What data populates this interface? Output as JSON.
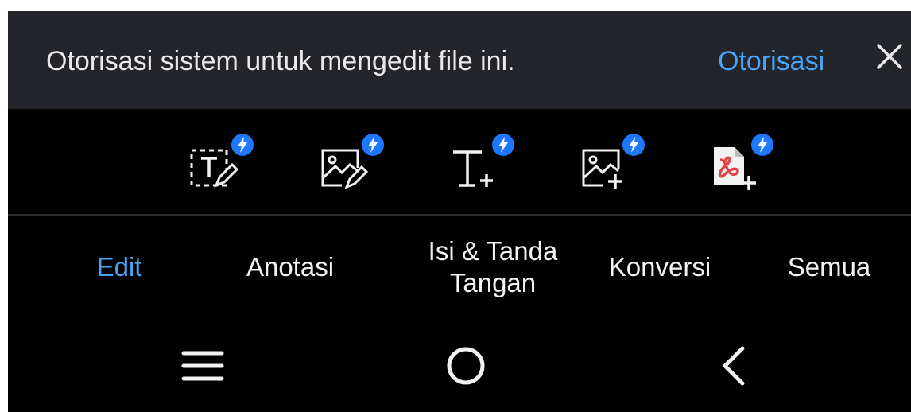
{
  "banner": {
    "message": "Otorisasi sistem untuk mengedit file ini.",
    "action_label": "Otorisasi",
    "close_icon": "close-icon"
  },
  "toolbar": {
    "tools": [
      {
        "icon": "edit-text-icon",
        "badge": "lightning-badge-icon"
      },
      {
        "icon": "edit-image-icon",
        "badge": "lightning-badge-icon"
      },
      {
        "icon": "add-text-icon",
        "badge": "lightning-badge-icon"
      },
      {
        "icon": "add-image-icon",
        "badge": "lightning-badge-icon"
      },
      {
        "icon": "add-pdf-page-icon",
        "badge": "lightning-badge-icon"
      }
    ]
  },
  "tabs": [
    {
      "label": "Edit",
      "active": true
    },
    {
      "label": "Anotasi",
      "active": false
    },
    {
      "label": "Isi & Tanda Tangan",
      "active": false
    },
    {
      "label": "Konversi",
      "active": false
    },
    {
      "label": "Semua",
      "active": false
    }
  ],
  "nav": {
    "recents_icon": "recents-menu-icon",
    "home_icon": "home-circle-icon",
    "back_icon": "back-chevron-icon"
  },
  "colors": {
    "accent": "#4aa3f5",
    "badge": "#1e78ff",
    "pdf_red": "#e0434a",
    "banner_bg": "#23252b"
  }
}
